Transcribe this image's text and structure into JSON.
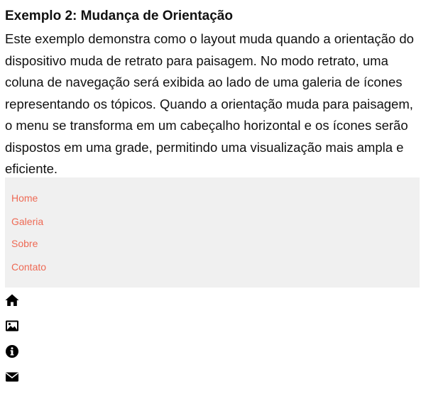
{
  "page": {
    "title": "Exemplo 2: Mudança de Orientação",
    "description": "Este exemplo demonstra como o layout muda quando a orientação do dispositivo muda de retrato para paisagem. No modo retrato, uma coluna de navegação será exibida ao lado de uma galeria de ícones representando os tópicos. Quando a orientação muda para paisagem, o menu se transforma em um cabeçalho horizontal e os ícones serão dispostos em uma grade, permitindo uma visualização mais ampla e eficiente."
  },
  "nav": {
    "background": "#f0f0f0",
    "link_color": "#ee6a55",
    "items": [
      {
        "label": "Home"
      },
      {
        "label": "Galeria"
      },
      {
        "label": "Sobre"
      },
      {
        "label": "Contato"
      }
    ]
  },
  "gallery": {
    "icons": [
      "home-icon",
      "image-icon",
      "info-icon",
      "envelope-icon"
    ]
  }
}
